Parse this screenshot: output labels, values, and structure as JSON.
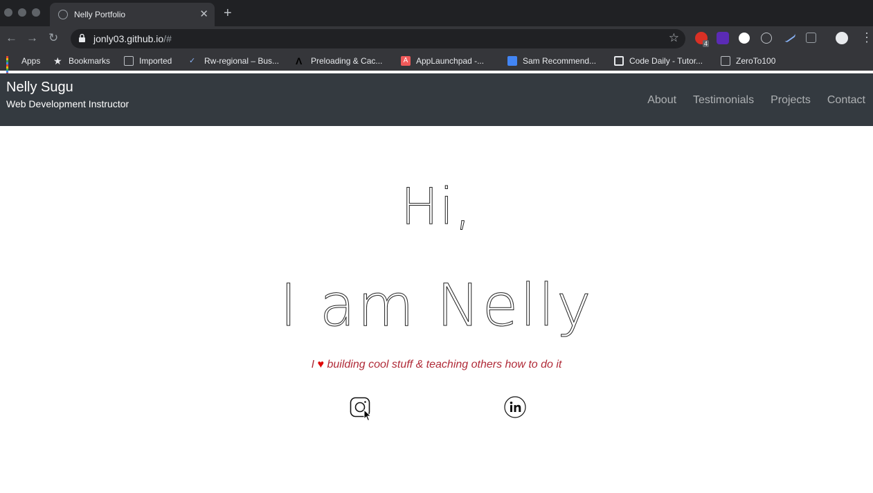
{
  "browser": {
    "tab_title": "Nelly Portfolio",
    "tab_close": "✕",
    "new_tab": "+",
    "url_host": "jonly03.github.io",
    "url_path": "/#",
    "star": "☆",
    "menu": "⋮",
    "extension_badge": "4",
    "bookmarks": [
      {
        "label": "Apps",
        "icon": "apps-grid-icon"
      },
      {
        "label": "Bookmarks",
        "icon": "star-icon"
      },
      {
        "label": "Imported",
        "icon": "folder-icon"
      },
      {
        "label": "Rw-regional – Bus...",
        "icon": "site-icon"
      },
      {
        "label": "Preloading & Cac...",
        "icon": "site-icon"
      },
      {
        "label": "AppLaunchpad -...",
        "icon": "applaunchpad-icon"
      },
      {
        "label": "Sam Recommend...",
        "icon": "doc-icon"
      },
      {
        "label": "Code Daily - Tutor...",
        "icon": "site-icon"
      },
      {
        "label": "ZeroTo100",
        "icon": "folder-icon"
      }
    ]
  },
  "site": {
    "brand_name": "Nelly Sugu",
    "brand_subtitle": "Web Development Instructor",
    "nav": [
      "About",
      "Testimonials",
      "Projects",
      "Contact"
    ],
    "greeting_line1": "Hi,",
    "greeting_line2": "I am Nelly",
    "tagline_prefix": "I",
    "tagline_heart": "♥",
    "tagline_rest": "building cool stuff & teaching others how to do it",
    "social": [
      "instagram-icon",
      "linkedin-icon"
    ]
  },
  "colors": {
    "header_bg": "#343a40",
    "tagline": "#b02a37",
    "heart": "#e00000"
  }
}
